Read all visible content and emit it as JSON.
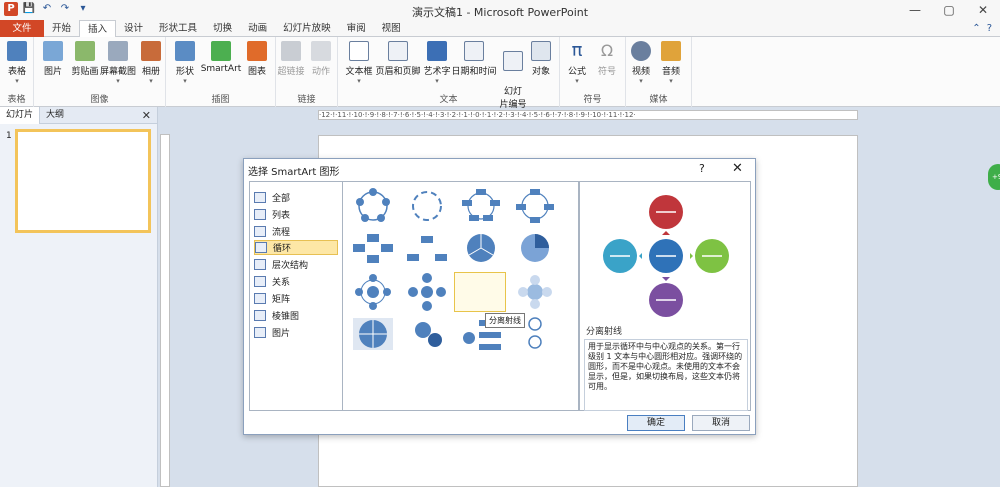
{
  "window": {
    "title": "演示文稿1 - Microsoft PowerPoint",
    "controls": [
      "—",
      "▢",
      "✕"
    ]
  },
  "quick_access": [
    "P",
    "💾",
    "↶",
    "↷",
    "▾"
  ],
  "tabs": [
    "文件",
    "开始",
    "插入",
    "设计",
    "形状工具",
    "切换",
    "动画",
    "幻灯片放映",
    "审阅",
    "视图"
  ],
  "tabs_right": [
    "⌃",
    "?"
  ],
  "ribbon": {
    "groups": [
      {
        "label": "表格",
        "buttons": [
          {
            "label": "表格",
            "icon": "table-icon"
          }
        ]
      },
      {
        "label": "图像",
        "buttons": [
          {
            "label": "图片",
            "icon": "picture-icon"
          },
          {
            "label": "剪贴画",
            "icon": "clipart-icon"
          },
          {
            "label": "屏幕截图",
            "icon": "screenshot-icon"
          },
          {
            "label": "相册",
            "icon": "album-icon"
          }
        ]
      },
      {
        "label": "插图",
        "buttons": [
          {
            "label": "形状",
            "icon": "shapes-icon"
          },
          {
            "label": "SmartArt",
            "icon": "smartart-icon"
          },
          {
            "label": "图表",
            "icon": "chart-icon"
          }
        ]
      },
      {
        "label": "链接",
        "buttons": [
          {
            "label": "超链接",
            "icon": "hyperlink-icon"
          },
          {
            "label": "动作",
            "icon": "action-icon"
          }
        ]
      },
      {
        "label": "文本",
        "buttons": [
          {
            "label": "文本框",
            "icon": "textbox-icon"
          },
          {
            "label": "页眉和页脚",
            "icon": "header-footer-icon"
          },
          {
            "label": "艺术字",
            "icon": "wordart-icon"
          },
          {
            "label": "日期和时间",
            "icon": "datetime-icon"
          },
          {
            "label": "幻灯\n片编号",
            "icon": "slide-number-icon"
          },
          {
            "label": "对象",
            "icon": "object-icon"
          }
        ]
      },
      {
        "label": "符号",
        "buttons": [
          {
            "label": "公式",
            "icon": "equation-icon"
          },
          {
            "label": "符号",
            "icon": "symbol-icon"
          }
        ]
      },
      {
        "label": "媒体",
        "buttons": [
          {
            "label": "视频",
            "icon": "video-icon"
          },
          {
            "label": "音频",
            "icon": "audio-icon"
          }
        ]
      }
    ]
  },
  "left_pane": {
    "tabs": [
      "幻灯片",
      "大纲"
    ],
    "close": "✕",
    "slide_number": "1"
  },
  "ruler_text": "·12·!·11·!·10·!·9·!·8·!·7·!·6·!·5·!·4·!·3·!·2·!·1·!·0·!·1·!·2·!·3·!·4·!·5·!·6·!·7·!·8·!·9·!·10·!·11·!·12·",
  "badge": "+9",
  "dialog": {
    "title": "选择 SmartArt 图形",
    "help": "?",
    "close": "✕",
    "categories": [
      "全部",
      "列表",
      "流程",
      "循环",
      "层次结构",
      "关系",
      "矩阵",
      "棱锥图",
      "图片"
    ],
    "selected_category": "循环",
    "tooltip": "分离射线",
    "preview_title": "分离射线",
    "preview_description": "用于显示循环中与中心观点的关系。第一行级别 1 文本与中心圆形相对应。强调环绕的圆形，而不是中心观点。未使用的文本不会显示，但是，如果切换布局，这些文本仍将可用。",
    "ok": "确定",
    "cancel": "取消",
    "colors": {
      "top": "#c0363b",
      "left": "#3aa3c8",
      "center": "#2f72b8",
      "right": "#7ec243",
      "bottom": "#7b4fa0",
      "accent": "#4f81bd"
    }
  }
}
